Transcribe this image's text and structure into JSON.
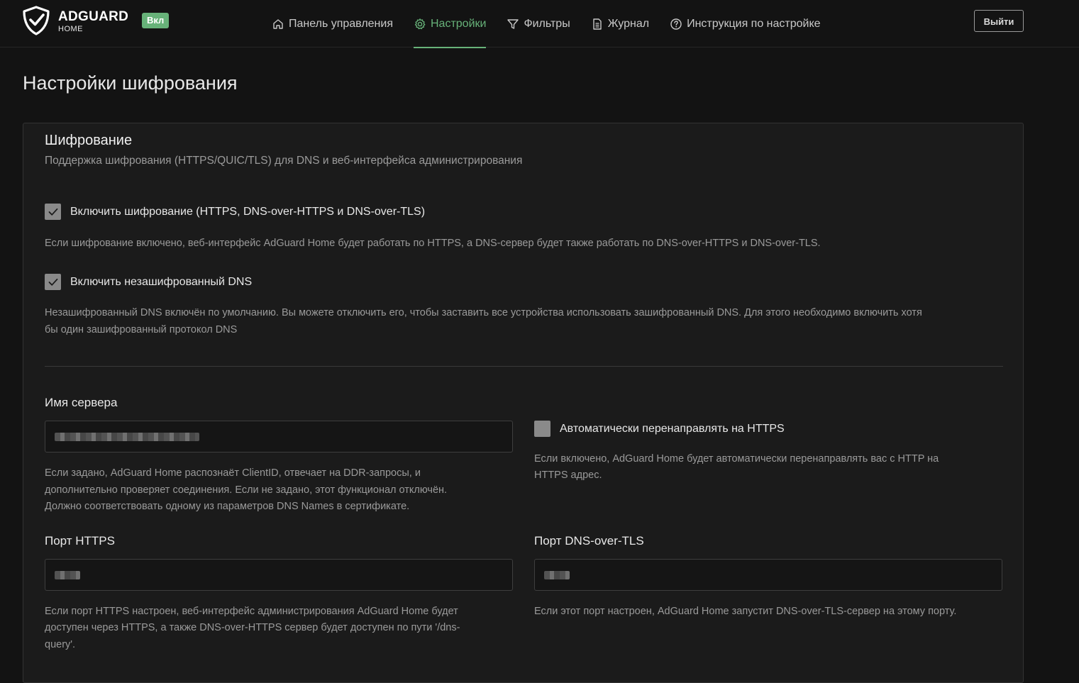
{
  "header": {
    "logo_text": "ADGUARD",
    "logo_sub": "HOME",
    "status_badge": "Вкл",
    "nav": [
      {
        "label": "Панель управления",
        "icon": "home-icon"
      },
      {
        "label": "Настройки",
        "icon": "gear-icon",
        "active": true
      },
      {
        "label": "Фильтры",
        "icon": "filter-icon"
      },
      {
        "label": "Журнал",
        "icon": "log-icon"
      },
      {
        "label": "Инструкция по настройке",
        "icon": "help-icon"
      }
    ],
    "logout_label": "Выйти"
  },
  "page": {
    "title": "Настройки шифрования"
  },
  "encryption": {
    "title": "Шифрование",
    "subtitle": "Поддержка шифрования (HTTPS/QUIC/TLS) для DNS и веб-интерфейса администрирования",
    "enable": {
      "label": "Включить шифрование (HTTPS, DNS-over-HTTPS и DNS-over-TLS)",
      "checked": true,
      "hint": "Если шифрование включено, веб-интерфейс AdGuard Home будет работать по HTTPS, а DNS-сервер будет также работать по DNS-over-HTTPS и DNS-over-TLS."
    },
    "plain_dns": {
      "label": "Включить незашифрованный DNS",
      "checked": true,
      "hint_line1": "Незашифрованный DNS включён по умолчанию. Вы можете отключить его, чтобы заставить все устройства использовать зашифрованный DNS. Для этого необходимо включить хотя",
      "hint_line2": "бы один зашифрованный протокол DNS"
    },
    "server_name": {
      "label": "Имя сервера",
      "hint_line1": "Если задано, AdGuard Home распознаёт ClientID, отвечает на DDR-запросы, и",
      "hint_line2": "дополнительно проверяет соединения. Если не задано, этот функционал отключён.",
      "hint_line3": "Должно соответствовать одному из параметров DNS Names в сертификате."
    },
    "redirect_https": {
      "label": "Автоматически перенаправлять на HTTPS",
      "checked": false,
      "hint_line1": "Если включено, AdGuard Home будет автоматически перенаправлять вас с HTTP на",
      "hint_line2": "HTTPS адрес."
    },
    "https_port": {
      "label": "Порт HTTPS",
      "hint_line1": "Если порт HTTPS настроен, веб-интерфейс администрирования AdGuard Home будет",
      "hint_line2": "доступен через HTTPS, а также DNS-over-HTTPS сервер будет доступен по пути '/dns-",
      "hint_line3": "query'."
    },
    "dot_port": {
      "label": "Порт DNS-over-TLS",
      "hint": "Если этот порт настроен, AdGuard Home запустит DNS-over-TLS-сервер на этому порту."
    }
  },
  "colors": {
    "accent": "#67b279",
    "background": "#131313",
    "card": "#1b1b1b"
  }
}
